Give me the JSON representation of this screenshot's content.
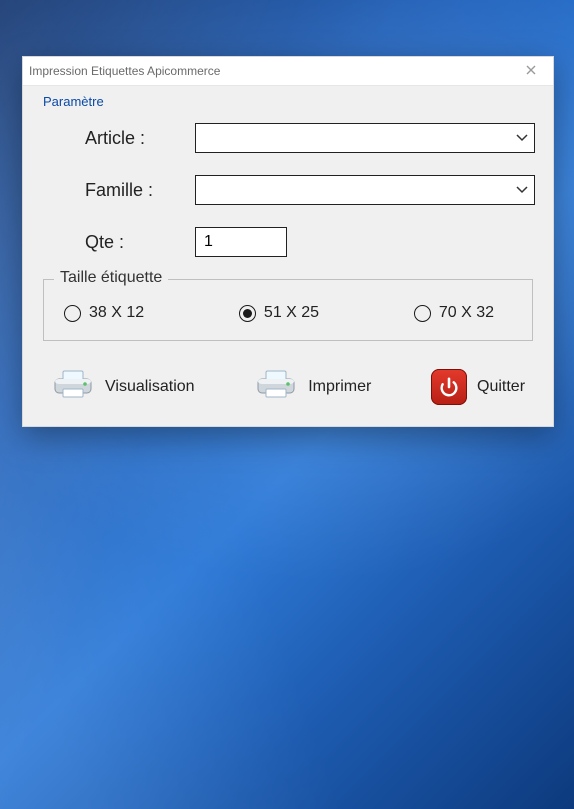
{
  "window": {
    "title": "Impression Etiquettes Apicommerce",
    "menu_param": "Paramètre"
  },
  "form": {
    "article_label": "Article :",
    "article_value": "",
    "famille_label": "Famille :",
    "famille_value": "",
    "qte_label": "Qte :",
    "qte_value": "1"
  },
  "size_group": {
    "legend": "Taille étiquette",
    "options": [
      {
        "label": "38 X 12",
        "selected": false
      },
      {
        "label": "51 X 25",
        "selected": true
      },
      {
        "label": "70 X 32",
        "selected": false
      }
    ]
  },
  "actions": {
    "visualisation": "Visualisation",
    "imprimer": "Imprimer",
    "quitter": "Quitter"
  }
}
